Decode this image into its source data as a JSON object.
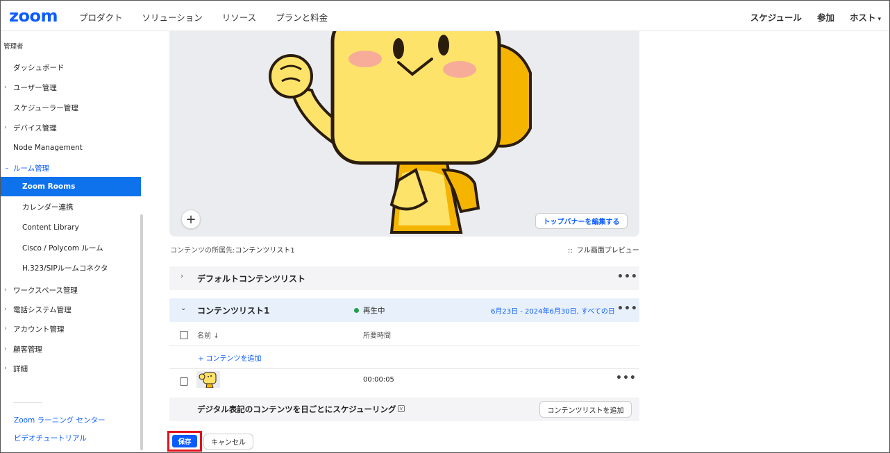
{
  "topnav": {
    "logo": "zoom",
    "left": [
      "プロダクト",
      "ソリューション",
      "リソース",
      "プランと料金"
    ],
    "right": [
      "スケジュール",
      "参加",
      "ホスト"
    ]
  },
  "sidebar": {
    "heading": "管理者",
    "items": [
      {
        "label": "ダッシュボード"
      },
      {
        "label": "ユーザー管理"
      },
      {
        "label": "スケジューラー管理"
      },
      {
        "label": "デバイス管理"
      },
      {
        "label": "Node Management"
      },
      {
        "label": "ルーム管理"
      },
      {
        "label": "Zoom Rooms"
      },
      {
        "label": "カレンダー連携"
      },
      {
        "label": "Content Library"
      },
      {
        "label": "Cisco / Polycom ルーム"
      },
      {
        "label": "H.323/SIPルームコネクタ"
      },
      {
        "label": "ワークスペース管理"
      },
      {
        "label": "電話システム管理"
      },
      {
        "label": "アカウント管理"
      },
      {
        "label": "顧客管理"
      },
      {
        "label": "詳細"
      }
    ],
    "links": [
      "Zoom ラーニング センター",
      "ビデオチュートリアル"
    ]
  },
  "banner": {
    "edit_label": "トップバナーを編集する",
    "plus": "+"
  },
  "content": {
    "belongs_label": "コンテンツの所属先:",
    "belongs_value": "コンテンツリスト1",
    "fullscreen_icon": "::",
    "fullscreen_label": "フル画面プレビュー",
    "default_list": "デフォルトコンテンツリスト",
    "list1": {
      "title": "コンテンツリスト1",
      "status": "再生中",
      "range": "6月23日 - 2024年6月30日, すべての日",
      "col_name": "名前",
      "col_duration": "所要時間",
      "add_content": "+ コンテンツを追加",
      "items": [
        {
          "duration": "00:00:05"
        }
      ]
    },
    "more": "•••",
    "schedule_label": "デジタル表記のコンテンツを日ごとにスケジューリング",
    "add_list_label": "コンテンツリストを追加"
  },
  "footer": {
    "save": "保存",
    "cancel": "キャンセル"
  },
  "colors": {
    "accent": "#0b5cff",
    "active_sidebar": "#0e72ed",
    "status_green": "#21a04b",
    "highlight_red": "#e0121c"
  }
}
